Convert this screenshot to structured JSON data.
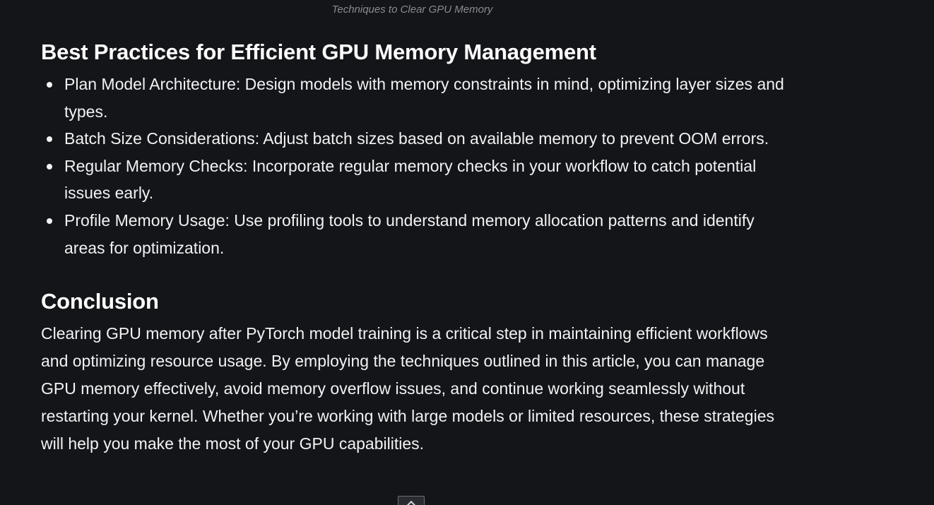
{
  "caption": "Techniques to Clear GPU Memory",
  "best_practices": {
    "heading": "Best Practices for Efficient GPU Memory Management",
    "items": [
      "Plan Model Architecture: Design models with memory constraints in mind, optimizing layer sizes and types.",
      "Batch Size Considerations: Adjust batch sizes based on available memory to prevent OOM errors.",
      "Regular Memory Checks: Incorporate regular memory checks in your workflow to catch potential issues early.",
      "Profile Memory Usage: Use profiling tools to understand memory allocation patterns and identify areas for optimization."
    ]
  },
  "conclusion": {
    "heading": "Conclusion",
    "text": "Clearing GPU memory after PyTorch model training is a critical step in maintaining efficient workflows and optimizing resource usage. By employing the techniques outlined in this article, you can manage GPU memory effectively, avoid memory overflow issues, and continue working seamlessly without restarting your kernel. Whether you’re working with large models or limited resources, these strategies will help you make the most of your GPU capabilities."
  },
  "icons": {
    "scroll_top": "chevron-up-icon"
  }
}
